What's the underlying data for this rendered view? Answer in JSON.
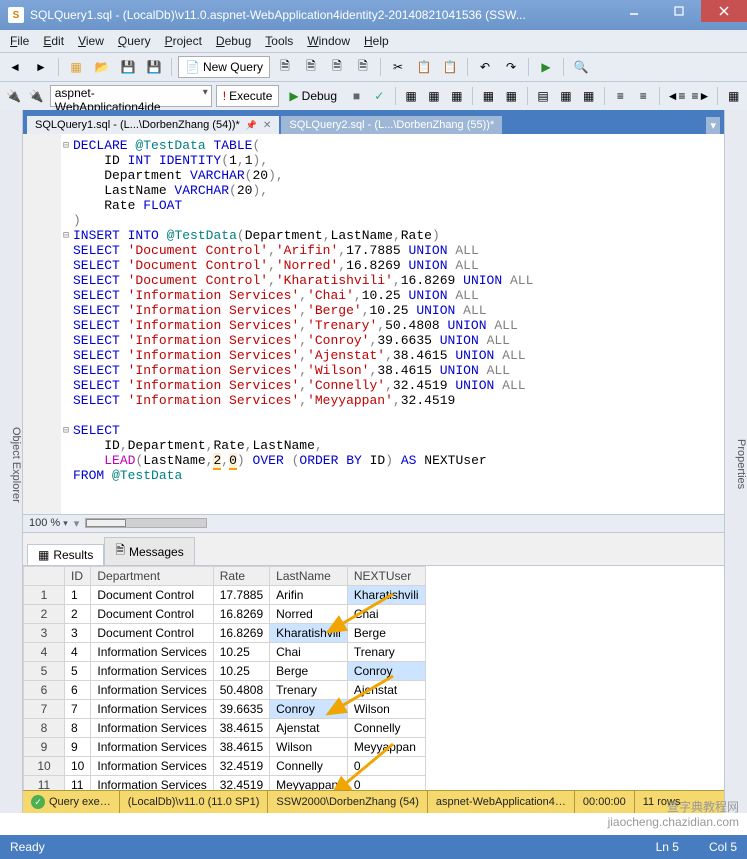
{
  "window": {
    "title": "SQLQuery1.sql - (LocalDb)\\v11.0.aspnet-WebApplication4identity2-20140821041536 (SSW..."
  },
  "menu": [
    "File",
    "Edit",
    "View",
    "Query",
    "Project",
    "Debug",
    "Tools",
    "Window",
    "Help"
  ],
  "toolbar": {
    "new_query": "New Query",
    "db_combo": "aspnet-WebApplication4ide",
    "execute": "Execute",
    "debug": "Debug"
  },
  "side_left": "Object Explorer",
  "side_right": "Properties",
  "tabs": [
    {
      "label": "SQLQuery1.sql - (L...\\DorbenZhang (54))*",
      "active": true
    },
    {
      "label": "SQLQuery2.sql - (L...\\DorbenZhang (55))*",
      "active": false
    }
  ],
  "zoom": "100 %",
  "sql_lines": [
    [
      {
        "t": "DECLARE",
        "c": "kw"
      },
      {
        "t": " ",
        "c": ""
      },
      {
        "t": "@TestData",
        "c": "teal"
      },
      {
        "t": " ",
        "c": ""
      },
      {
        "t": "TABLE",
        "c": "kw"
      },
      {
        "t": "(",
        "c": "gr"
      }
    ],
    [
      {
        "t": "    ID ",
        "c": ""
      },
      {
        "t": "INT",
        "c": "kw"
      },
      {
        "t": " ",
        "c": ""
      },
      {
        "t": "IDENTITY",
        "c": "kw"
      },
      {
        "t": "(",
        "c": "gr"
      },
      {
        "t": "1",
        "c": ""
      },
      {
        "t": ",",
        "c": "gr"
      },
      {
        "t": "1",
        "c": ""
      },
      {
        "t": ")",
        "c": "gr"
      },
      {
        "t": ",",
        "c": "gr"
      }
    ],
    [
      {
        "t": "    Department ",
        "c": ""
      },
      {
        "t": "VARCHAR",
        "c": "kw"
      },
      {
        "t": "(",
        "c": "gr"
      },
      {
        "t": "20",
        "c": ""
      },
      {
        "t": ")",
        "c": "gr"
      },
      {
        "t": ",",
        "c": "gr"
      }
    ],
    [
      {
        "t": "    LastName ",
        "c": ""
      },
      {
        "t": "VARCHAR",
        "c": "kw"
      },
      {
        "t": "(",
        "c": "gr"
      },
      {
        "t": "20",
        "c": ""
      },
      {
        "t": ")",
        "c": "gr"
      },
      {
        "t": ",",
        "c": "gr"
      }
    ],
    [
      {
        "t": "    Rate ",
        "c": ""
      },
      {
        "t": "FLOAT",
        "c": "kw"
      }
    ],
    [
      {
        "t": ")",
        "c": "gr"
      }
    ],
    [
      {
        "t": "INSERT",
        "c": "kw"
      },
      {
        "t": " ",
        "c": ""
      },
      {
        "t": "INTO",
        "c": "kw"
      },
      {
        "t": " ",
        "c": ""
      },
      {
        "t": "@TestData",
        "c": "teal"
      },
      {
        "t": "(",
        "c": "gr"
      },
      {
        "t": "Department",
        "c": ""
      },
      {
        "t": ",",
        "c": "gr"
      },
      {
        "t": "LastName",
        "c": ""
      },
      {
        "t": ",",
        "c": "gr"
      },
      {
        "t": "Rate",
        "c": ""
      },
      {
        "t": ")",
        "c": "gr"
      }
    ],
    [
      {
        "t": "SELECT",
        "c": "kw"
      },
      {
        "t": " ",
        "c": ""
      },
      {
        "t": "'Document Control'",
        "c": "str"
      },
      {
        "t": ",",
        "c": "gr"
      },
      {
        "t": "'Arifin'",
        "c": "str"
      },
      {
        "t": ",",
        "c": "gr"
      },
      {
        "t": "17.7885 ",
        "c": ""
      },
      {
        "t": "UNION",
        "c": "kw"
      },
      {
        "t": " ",
        "c": ""
      },
      {
        "t": "ALL",
        "c": "gr"
      }
    ],
    [
      {
        "t": "SELECT",
        "c": "kw"
      },
      {
        "t": " ",
        "c": ""
      },
      {
        "t": "'Document Control'",
        "c": "str"
      },
      {
        "t": ",",
        "c": "gr"
      },
      {
        "t": "'Norred'",
        "c": "str"
      },
      {
        "t": ",",
        "c": "gr"
      },
      {
        "t": "16.8269 ",
        "c": ""
      },
      {
        "t": "UNION",
        "c": "kw"
      },
      {
        "t": " ",
        "c": ""
      },
      {
        "t": "ALL",
        "c": "gr"
      }
    ],
    [
      {
        "t": "SELECT",
        "c": "kw"
      },
      {
        "t": " ",
        "c": ""
      },
      {
        "t": "'Document Control'",
        "c": "str"
      },
      {
        "t": ",",
        "c": "gr"
      },
      {
        "t": "'Kharatishvili'",
        "c": "str"
      },
      {
        "t": ",",
        "c": "gr"
      },
      {
        "t": "16.8269 ",
        "c": ""
      },
      {
        "t": "UNION",
        "c": "kw"
      },
      {
        "t": " ",
        "c": ""
      },
      {
        "t": "ALL",
        "c": "gr"
      }
    ],
    [
      {
        "t": "SELECT",
        "c": "kw"
      },
      {
        "t": " ",
        "c": ""
      },
      {
        "t": "'Information Services'",
        "c": "str"
      },
      {
        "t": ",",
        "c": "gr"
      },
      {
        "t": "'Chai'",
        "c": "str"
      },
      {
        "t": ",",
        "c": "gr"
      },
      {
        "t": "10.25 ",
        "c": ""
      },
      {
        "t": "UNION",
        "c": "kw"
      },
      {
        "t": " ",
        "c": ""
      },
      {
        "t": "ALL",
        "c": "gr"
      }
    ],
    [
      {
        "t": "SELECT",
        "c": "kw"
      },
      {
        "t": " ",
        "c": ""
      },
      {
        "t": "'Information Services'",
        "c": "str"
      },
      {
        "t": ",",
        "c": "gr"
      },
      {
        "t": "'Berge'",
        "c": "str"
      },
      {
        "t": ",",
        "c": "gr"
      },
      {
        "t": "10.25 ",
        "c": ""
      },
      {
        "t": "UNION",
        "c": "kw"
      },
      {
        "t": " ",
        "c": ""
      },
      {
        "t": "ALL",
        "c": "gr"
      }
    ],
    [
      {
        "t": "SELECT",
        "c": "kw"
      },
      {
        "t": " ",
        "c": ""
      },
      {
        "t": "'Information Services'",
        "c": "str"
      },
      {
        "t": ",",
        "c": "gr"
      },
      {
        "t": "'Trenary'",
        "c": "str"
      },
      {
        "t": ",",
        "c": "gr"
      },
      {
        "t": "50.4808 ",
        "c": ""
      },
      {
        "t": "UNION",
        "c": "kw"
      },
      {
        "t": " ",
        "c": ""
      },
      {
        "t": "ALL",
        "c": "gr"
      }
    ],
    [
      {
        "t": "SELECT",
        "c": "kw"
      },
      {
        "t": " ",
        "c": ""
      },
      {
        "t": "'Information Services'",
        "c": "str"
      },
      {
        "t": ",",
        "c": "gr"
      },
      {
        "t": "'Conroy'",
        "c": "str"
      },
      {
        "t": ",",
        "c": "gr"
      },
      {
        "t": "39.6635 ",
        "c": ""
      },
      {
        "t": "UNION",
        "c": "kw"
      },
      {
        "t": " ",
        "c": ""
      },
      {
        "t": "ALL",
        "c": "gr"
      }
    ],
    [
      {
        "t": "SELECT",
        "c": "kw"
      },
      {
        "t": " ",
        "c": ""
      },
      {
        "t": "'Information Services'",
        "c": "str"
      },
      {
        "t": ",",
        "c": "gr"
      },
      {
        "t": "'Ajenstat'",
        "c": "str"
      },
      {
        "t": ",",
        "c": "gr"
      },
      {
        "t": "38.4615 ",
        "c": ""
      },
      {
        "t": "UNION",
        "c": "kw"
      },
      {
        "t": " ",
        "c": ""
      },
      {
        "t": "ALL",
        "c": "gr"
      }
    ],
    [
      {
        "t": "SELECT",
        "c": "kw"
      },
      {
        "t": " ",
        "c": ""
      },
      {
        "t": "'Information Services'",
        "c": "str"
      },
      {
        "t": ",",
        "c": "gr"
      },
      {
        "t": "'Wilson'",
        "c": "str"
      },
      {
        "t": ",",
        "c": "gr"
      },
      {
        "t": "38.4615 ",
        "c": ""
      },
      {
        "t": "UNION",
        "c": "kw"
      },
      {
        "t": " ",
        "c": ""
      },
      {
        "t": "ALL",
        "c": "gr"
      }
    ],
    [
      {
        "t": "SELECT",
        "c": "kw"
      },
      {
        "t": " ",
        "c": ""
      },
      {
        "t": "'Information Services'",
        "c": "str"
      },
      {
        "t": ",",
        "c": "gr"
      },
      {
        "t": "'Connelly'",
        "c": "str"
      },
      {
        "t": ",",
        "c": "gr"
      },
      {
        "t": "32.4519 ",
        "c": ""
      },
      {
        "t": "UNION",
        "c": "kw"
      },
      {
        "t": " ",
        "c": ""
      },
      {
        "t": "ALL",
        "c": "gr"
      }
    ],
    [
      {
        "t": "SELECT",
        "c": "kw"
      },
      {
        "t": " ",
        "c": ""
      },
      {
        "t": "'Information Services'",
        "c": "str"
      },
      {
        "t": ",",
        "c": "gr"
      },
      {
        "t": "'Meyyappan'",
        "c": "str"
      },
      {
        "t": ",",
        "c": "gr"
      },
      {
        "t": "32.4519",
        "c": ""
      }
    ],
    [
      {
        "t": " ",
        "c": ""
      }
    ],
    [
      {
        "t": "SELECT",
        "c": "kw"
      }
    ],
    [
      {
        "t": "    ID",
        "c": ""
      },
      {
        "t": ",",
        "c": "gr"
      },
      {
        "t": "Department",
        "c": ""
      },
      {
        "t": ",",
        "c": "gr"
      },
      {
        "t": "Rate",
        "c": ""
      },
      {
        "t": ",",
        "c": "gr"
      },
      {
        "t": "LastName",
        "c": ""
      },
      {
        "t": ",",
        "c": "gr"
      }
    ],
    [
      {
        "t": "    ",
        "c": ""
      },
      {
        "t": "LEAD",
        "c": "fn"
      },
      {
        "t": "(",
        "c": "gr"
      },
      {
        "t": "LastName",
        "c": ""
      },
      {
        "t": ",",
        "c": "gr"
      },
      {
        "t": "2",
        "c": "hl"
      },
      {
        "t": ",",
        "c": "gr"
      },
      {
        "t": "0",
        "c": "hl"
      },
      {
        "t": ")",
        "c": "gr"
      },
      {
        "t": " ",
        "c": ""
      },
      {
        "t": "OVER",
        "c": "kw"
      },
      {
        "t": " ",
        "c": ""
      },
      {
        "t": "(",
        "c": "gr"
      },
      {
        "t": "ORDER",
        "c": "kw"
      },
      {
        "t": " ",
        "c": ""
      },
      {
        "t": "BY",
        "c": "kw"
      },
      {
        "t": " ID",
        "c": ""
      },
      {
        "t": ")",
        "c": "gr"
      },
      {
        "t": " ",
        "c": ""
      },
      {
        "t": "AS",
        "c": "kw"
      },
      {
        "t": " NEXTUser",
        "c": ""
      }
    ],
    [
      {
        "t": "FROM",
        "c": "kw"
      },
      {
        "t": " ",
        "c": ""
      },
      {
        "t": "@TestData",
        "c": "teal"
      }
    ]
  ],
  "result_tabs": {
    "results": "Results",
    "messages": "Messages"
  },
  "result_cols": [
    "",
    "ID",
    "Department",
    "Rate",
    "LastName",
    "NEXTUser"
  ],
  "result_rows": [
    {
      "n": "1",
      "ID": "1",
      "Department": "Document Control",
      "Rate": "17.7885",
      "LastName": "Arifin",
      "NEXTUser": "Kharatishvili",
      "hl": [
        5
      ]
    },
    {
      "n": "2",
      "ID": "2",
      "Department": "Document Control",
      "Rate": "16.8269",
      "LastName": "Norred",
      "NEXTUser": "Chai"
    },
    {
      "n": "3",
      "ID": "3",
      "Department": "Document Control",
      "Rate": "16.8269",
      "LastName": "Kharatishvili",
      "NEXTUser": "Berge",
      "hl": [
        4
      ]
    },
    {
      "n": "4",
      "ID": "4",
      "Department": "Information Services",
      "Rate": "10.25",
      "LastName": "Chai",
      "NEXTUser": "Trenary"
    },
    {
      "n": "5",
      "ID": "5",
      "Department": "Information Services",
      "Rate": "10.25",
      "LastName": "Berge",
      "NEXTUser": "Conroy",
      "hl": [
        5
      ]
    },
    {
      "n": "6",
      "ID": "6",
      "Department": "Information Services",
      "Rate": "50.4808",
      "LastName": "Trenary",
      "NEXTUser": "Ajenstat"
    },
    {
      "n": "7",
      "ID": "7",
      "Department": "Information Services",
      "Rate": "39.6635",
      "LastName": "Conroy",
      "NEXTUser": "Wilson",
      "hl": [
        4
      ]
    },
    {
      "n": "8",
      "ID": "8",
      "Department": "Information Services",
      "Rate": "38.4615",
      "LastName": "Ajenstat",
      "NEXTUser": "Connelly"
    },
    {
      "n": "9",
      "ID": "9",
      "Department": "Information Services",
      "Rate": "38.4615",
      "LastName": "Wilson",
      "NEXTUser": "Meyyappan"
    },
    {
      "n": "10",
      "ID": "10",
      "Department": "Information Services",
      "Rate": "32.4519",
      "LastName": "Connelly",
      "NEXTUser": "0"
    },
    {
      "n": "11",
      "ID": "11",
      "Department": "Information Services",
      "Rate": "32.4519",
      "LastName": "Meyyappan",
      "NEXTUser": "0"
    }
  ],
  "yellow": {
    "status": "Query exe…",
    "server": "(LocalDb)\\v11.0 (11.0 SP1)",
    "user": "SSW2000\\DorbenZhang (54)",
    "db": "aspnet-WebApplication4…",
    "time": "00:00:00",
    "rows": "11 rows"
  },
  "status": {
    "ready": "Ready",
    "ln": "Ln 5",
    "col": "Col 5"
  },
  "watermark": "查字典教程网\njiaocheng.chazidian.com"
}
